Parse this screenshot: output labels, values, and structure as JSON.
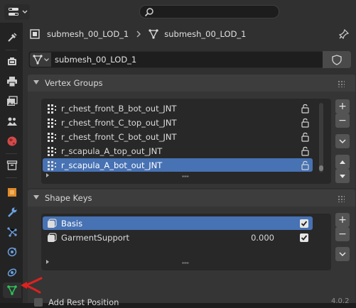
{
  "header": {
    "editor_type_icon": "properties-editor-icon",
    "search_icon": "search-icon",
    "search_value": ""
  },
  "tabs": [
    {
      "name": "tool-tab",
      "icon": "tool-icon",
      "active": false
    },
    {
      "name": "render-tab",
      "icon": "camera-back-icon",
      "active": false
    },
    {
      "name": "output-tab",
      "icon": "printer-icon",
      "active": false
    },
    {
      "name": "view-layer-tab",
      "icon": "image-stack-icon",
      "active": false
    },
    {
      "name": "scene-tab",
      "icon": "scene-icon",
      "active": false
    },
    {
      "name": "world-tab",
      "icon": "world-icon",
      "active": false
    },
    {
      "name": "collection-tab",
      "icon": "collection-box-icon",
      "active": false
    },
    {
      "name": "object-tab",
      "icon": "object-cube-icon",
      "active": false
    },
    {
      "name": "modifiers-tab",
      "icon": "wrench-icon",
      "active": false
    },
    {
      "name": "particles-tab",
      "icon": "particles-icon",
      "active": false
    },
    {
      "name": "physics-tab",
      "icon": "physics-orbit-icon",
      "active": false
    },
    {
      "name": "constraints-tab",
      "icon": "constraint-icon",
      "active": false
    },
    {
      "name": "data-tab",
      "icon": "mesh-data-icon",
      "active": true
    }
  ],
  "breadcrumb": {
    "object_name": "submesh_00_LOD_1",
    "mesh_name": "submesh_00_LOD_1"
  },
  "datablock": {
    "value": "submesh_00_LOD_1",
    "fake_user_icon": "shield-icon"
  },
  "vertex_groups": {
    "title": "Vertex Groups",
    "items": [
      {
        "label": "r_chest_front_B_bot_out_JNT",
        "selected": false
      },
      {
        "label": "r_chest_front_C_top_out_JNT",
        "selected": false
      },
      {
        "label": "r_chest_front_C_bot_out_JNT",
        "selected": false
      },
      {
        "label": "r_scapula_A_top_out_JNT",
        "selected": false
      },
      {
        "label": "r_scapula_A_bot_out_JNT",
        "selected": true
      }
    ],
    "add_label": "+",
    "remove_label": "−"
  },
  "shape_keys": {
    "title": "Shape Keys",
    "items": [
      {
        "label": "Basis",
        "value": "",
        "checked": true,
        "selected": true
      },
      {
        "label": "GarmentSupport",
        "value": "0.000",
        "checked": true,
        "selected": false
      }
    ],
    "add_label": "+",
    "remove_label": "−"
  },
  "rest_position": {
    "label": "Add Rest Position",
    "checked": false
  },
  "annotation": {
    "color": "#e02020",
    "shape": "arrow-pointing-left"
  },
  "version_fragment": "4.0.2",
  "colors": {
    "accent": "#4772b3",
    "panel": "#303030",
    "mesh_icon": "#2ec25a"
  }
}
